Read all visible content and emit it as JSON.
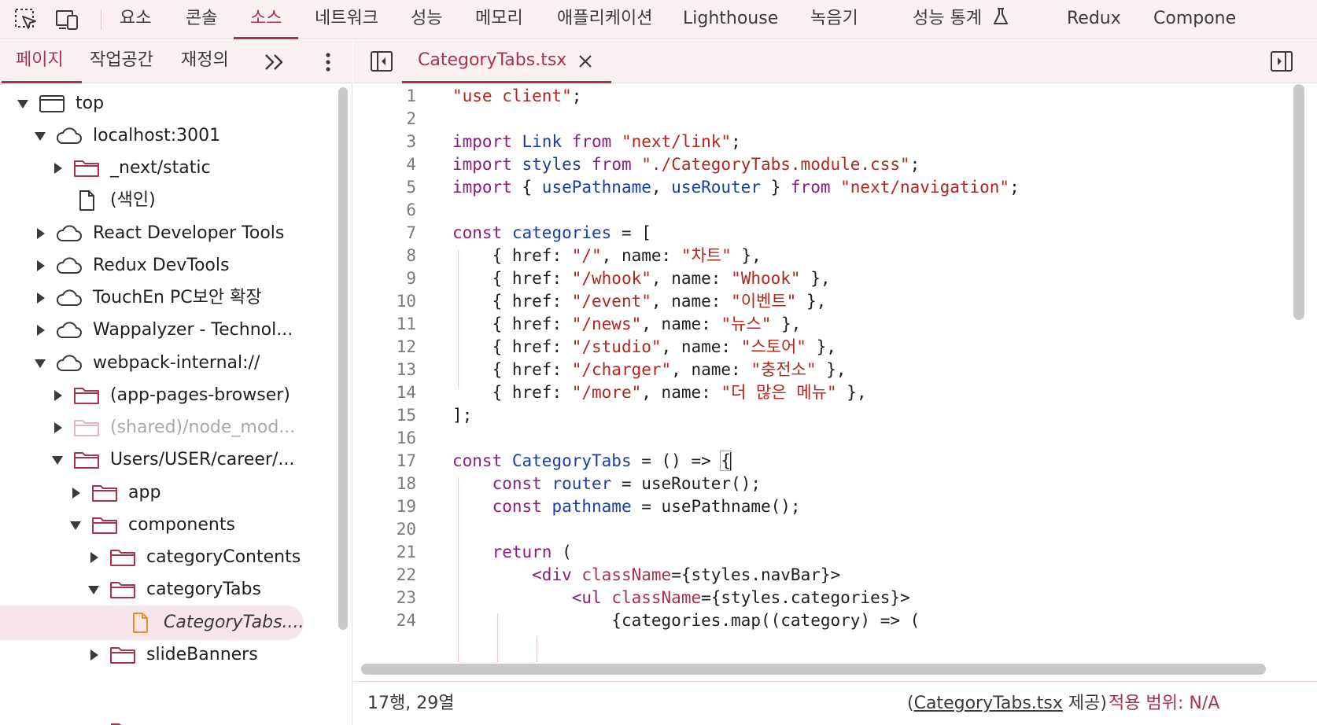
{
  "colors": {
    "accent": "#a8334a",
    "toolbar_bg": "#fbf1f3",
    "keyword": "#8a1e7a",
    "definition": "#1a3e9e",
    "string": "#b3261e",
    "folder": "#a8334a"
  },
  "toolbar": {
    "icons": [
      "element-picker-icon",
      "device-toggle-icon"
    ],
    "tabs": [
      {
        "label": "요소"
      },
      {
        "label": "콘솔"
      },
      {
        "label": "소스"
      },
      {
        "label": "네트워크"
      },
      {
        "label": "성능"
      },
      {
        "label": "메모리"
      },
      {
        "label": "애플리케이션"
      },
      {
        "label": "Lighthouse"
      },
      {
        "label": "녹음기"
      },
      {
        "label": "성능 통계"
      },
      {
        "label": "Redux"
      },
      {
        "label": "Compone"
      }
    ],
    "active_tab": "소스"
  },
  "navigator": {
    "tabs": [
      {
        "label": "페이지"
      },
      {
        "label": "작업공간"
      },
      {
        "label": "재정의"
      }
    ],
    "active_tab": "페이지",
    "tree": [
      {
        "label": "top",
        "icon": "frame-icon",
        "expanded": true
      },
      {
        "label": "localhost:3001",
        "icon": "cloud-icon",
        "expanded": true
      },
      {
        "label": "_next/static",
        "icon": "folder-icon",
        "expanded": false
      },
      {
        "label": "(색인)",
        "icon": "file-icon"
      },
      {
        "label": "React Developer Tools",
        "icon": "cloud-icon",
        "expanded": false
      },
      {
        "label": "Redux DevTools",
        "icon": "cloud-icon",
        "expanded": false
      },
      {
        "label": "TouchEn PC보안 확장",
        "icon": "cloud-icon",
        "expanded": false
      },
      {
        "label": "Wappalyzer - Technol...",
        "icon": "cloud-icon",
        "expanded": false
      },
      {
        "label": "webpack-internal://",
        "icon": "cloud-icon",
        "expanded": true
      },
      {
        "label": "(app-pages-browser)",
        "icon": "folder-icon",
        "expanded": false
      },
      {
        "label": "(shared)/node_mod...",
        "icon": "folder-icon",
        "expanded": false
      },
      {
        "label": "Users/USER/career/...",
        "icon": "folder-icon",
        "expanded": true
      },
      {
        "label": "app",
        "icon": "folder-icon",
        "expanded": false
      },
      {
        "label": "components",
        "icon": "folder-icon",
        "expanded": true
      },
      {
        "label": "categoryContents",
        "icon": "folder-icon",
        "expanded": false
      },
      {
        "label": "categoryTabs",
        "icon": "folder-icon",
        "expanded": true
      },
      {
        "label": "CategoryTabs....",
        "icon": "file-icon",
        "selected": true
      },
      {
        "label": "slideBanners",
        "icon": "folder-icon",
        "expanded": false
      }
    ]
  },
  "editor": {
    "file_tab": "CategoryTabs.tsx",
    "lines": [
      "\"use client\";",
      "",
      "import Link from \"next/link\";",
      "import styles from \"./CategoryTabs.module.css\";",
      "import { usePathname, useRouter } from \"next/navigation\";",
      "",
      "const categories = [",
      "    { href: \"/\", name: \"차트\" },",
      "    { href: \"/whook\", name: \"Whook\" },",
      "    { href: \"/event\", name: \"이벤트\" },",
      "    { href: \"/news\", name: \"뉴스\" },",
      "    { href: \"/studio\", name: \"스토어\" },",
      "    { href: \"/charger\", name: \"충전소\" },",
      "    { href: \"/more\", name: \"더 많은 메뉴\" },",
      "];",
      "",
      "const CategoryTabs = () => {",
      "    const router = useRouter();",
      "    const pathname = usePathname();",
      "",
      "    return (",
      "        <div className={styles.navBar}>",
      "            <ul className={styles.categories}>",
      "                {categories.map((category) => ("
    ],
    "status": {
      "position": "17행, 29열",
      "source_open": "(",
      "source_file": "CategoryTabs.tsx",
      "source_suffix": " 제공)",
      "coverage": "적용 범위: N/A"
    }
  }
}
